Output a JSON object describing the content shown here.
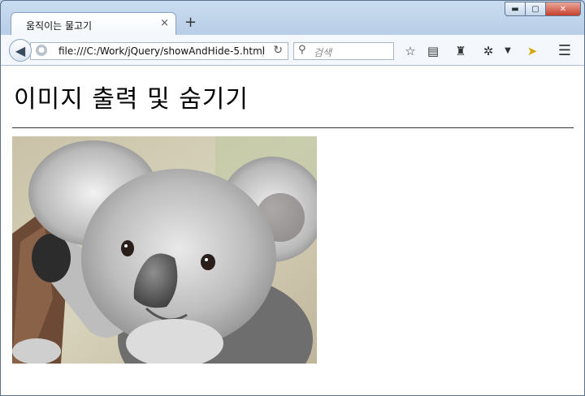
{
  "tab": {
    "title": "움직이는 물고기",
    "close": "×",
    "new_tab": "+"
  },
  "window": {
    "minimize": "▬",
    "maximize": "▢",
    "close": "✕"
  },
  "toolbar": {
    "url": "file:///C:/Work/jQuery/showAndHide-5.html",
    "search_placeholder": "검색"
  },
  "page": {
    "heading": "이미지 출력 및 숨기기"
  },
  "colors": {
    "chrome": "#b9cee7",
    "close_red": "#c8402d",
    "toolbar": "#f4f8fc"
  }
}
